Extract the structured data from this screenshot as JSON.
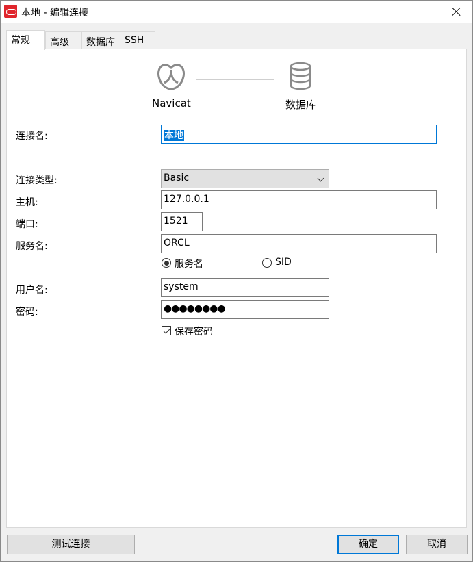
{
  "window": {
    "title": "本地 - 编辑连接"
  },
  "tabs": [
    {
      "label": "常规",
      "active": true
    },
    {
      "label": "高级",
      "active": false
    },
    {
      "label": "数据库",
      "active": false
    },
    {
      "label": "SSH",
      "active": false
    }
  ],
  "header": {
    "source_label": "Navicat",
    "target_label": "数据库",
    "source_icon": "navicat-logo-icon",
    "target_icon": "database-icon"
  },
  "form": {
    "connection_name": {
      "label": "连接名:",
      "value": "本地"
    },
    "connection_type": {
      "label": "连接类型:",
      "value": "Basic"
    },
    "host": {
      "label": "主机:",
      "value": "127.0.0.1"
    },
    "port": {
      "label": "端口:",
      "value": "1521"
    },
    "service_name": {
      "label": "服务名:",
      "value": "ORCL"
    },
    "service_type_options": [
      {
        "label": "服务名",
        "checked": true
      },
      {
        "label": "SID",
        "checked": false
      }
    ],
    "username": {
      "label": "用户名:",
      "value": "system"
    },
    "password": {
      "label": "密码:",
      "value": "●●●●●●●●"
    },
    "save_password": {
      "label": "保存密码",
      "checked": true
    }
  },
  "buttons": {
    "test": "测试连接",
    "ok": "确定",
    "cancel": "取消"
  },
  "colors": {
    "accent": "#0078d7",
    "brand": "#e0252c"
  }
}
